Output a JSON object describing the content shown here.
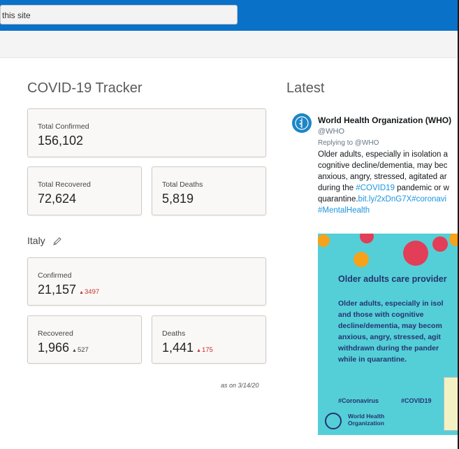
{
  "browser": {
    "search_text": "this site"
  },
  "tracker": {
    "title": "COVID-19 Tracker",
    "global": {
      "confirmed_label": "Total Confirmed",
      "confirmed_value": "156,102",
      "recovered_label": "Total Recovered",
      "recovered_value": "72,624",
      "deaths_label": "Total Deaths",
      "deaths_value": "5,819"
    },
    "country": {
      "name": "Italy",
      "confirmed_label": "Confirmed",
      "confirmed_value": "21,157",
      "confirmed_delta": "3497",
      "recovered_label": "Recovered",
      "recovered_value": "1,966",
      "recovered_delta": "527",
      "deaths_label": "Deaths",
      "deaths_value": "1,441",
      "deaths_delta": "175"
    },
    "as_on": "as on 3/14/20",
    "delta_color": "#c4312f"
  },
  "latest": {
    "title": "Latest",
    "tweet": {
      "name": "World Health Organization (WHO)",
      "handle": "@WHO",
      "replying": "Replying to @WHO",
      "line1": "Older adults, especially in isolation a",
      "line2": "cognitive decline/dementia, may bec",
      "line3": "anxious, angry, stressed, agitated ar",
      "line4_prefix": "during the ",
      "line4_link": "#COVID19",
      "line4_suffix": " pandemic or w",
      "line5_prefix": "quarantine.",
      "line5_link": "bit.ly/2xDnG7X#coronavi",
      "line6_link": "#MentalHealth",
      "poster": {
        "heading": "Older adults care provider",
        "body1": "Older adults, especially in isol",
        "body2": "and those with cognitive",
        "body3": "decline/dementia, may becom",
        "body4": "anxious, angry, stressed, agit",
        "body5": "withdrawn during the pander",
        "body6": "while in quarantine.",
        "tag1": "#Coronavirus",
        "tag2": "#COVID19",
        "org1": "World Health",
        "org2": "Organization"
      }
    }
  },
  "colors": {
    "topbar": "#0a71c9",
    "poster_bg": "#54cfd8",
    "poster_text": "#26336e",
    "link": "#1b95e0"
  }
}
